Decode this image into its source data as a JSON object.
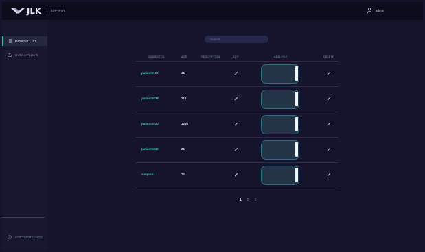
{
  "header": {
    "brand": "JLK",
    "product": "JDP-XYR",
    "user_name": "admin"
  },
  "sidebar": {
    "items": [
      {
        "label": "PATIENT LIST",
        "icon": "list-icon",
        "active": true
      },
      {
        "label": "DATA UPLOAD",
        "icon": "upload-icon",
        "active": false
      }
    ],
    "footer_label": "SOFTWARE INFO"
  },
  "search": {
    "placeholder": "Search"
  },
  "table": {
    "columns": [
      "SUBJECT ID",
      "AGE",
      "DESCRIPTION",
      "EDIT",
      "ANALYSIS",
      "DELETE"
    ],
    "rows": [
      {
        "subject_id": "patient0030",
        "age": "41",
        "description": "",
        "analysis_progress": 0.92
      },
      {
        "subject_id": "patient0033",
        "age": "214",
        "description": "",
        "analysis_progress": 0.92
      },
      {
        "subject_id": "patient2030",
        "age": "1240",
        "description": "",
        "analysis_progress": 0.92
      },
      {
        "subject_id": "patient1036",
        "age": "21",
        "description": "",
        "analysis_progress": 0.92
      },
      {
        "subject_id": "sangmo1",
        "age": "12",
        "description": "",
        "analysis_progress": 0.92
      }
    ]
  },
  "pagination": {
    "pages": [
      "1",
      "2",
      "3"
    ],
    "current": "1"
  },
  "colors": {
    "background": "#14152c",
    "topbar": "#0b0c1c",
    "sidebar": "#17182f",
    "accent": "#2ec4b0",
    "analysis_border": "#2f6a87"
  }
}
